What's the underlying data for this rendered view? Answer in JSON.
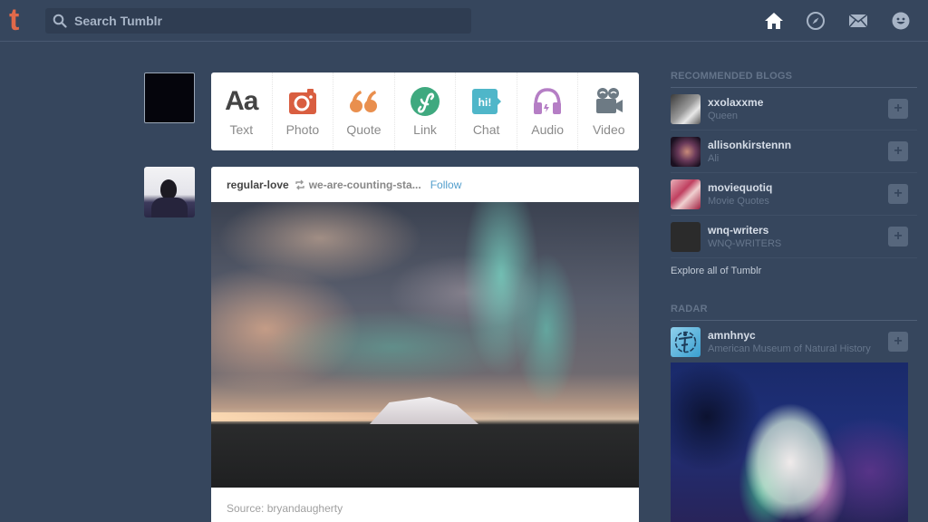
{
  "header": {
    "logo": "t",
    "search_placeholder": "Search Tumblr",
    "nav": [
      "home-icon",
      "explore-compass-icon",
      "inbox-mail-icon",
      "account-smiley-icon"
    ]
  },
  "post_types": [
    {
      "label": "Text",
      "icon": "text-icon",
      "color": "#444444"
    },
    {
      "label": "Photo",
      "icon": "camera-icon",
      "color": "#d95e40"
    },
    {
      "label": "Quote",
      "icon": "quote-icon",
      "color": "#f2992e"
    },
    {
      "label": "Link",
      "icon": "link-icon",
      "color": "#56bc8a"
    },
    {
      "label": "Chat",
      "icon": "chat-icon",
      "color": "#529ecc"
    },
    {
      "label": "Audio",
      "icon": "headphones-icon",
      "color": "#a77dc2"
    },
    {
      "label": "Video",
      "icon": "video-camera-icon",
      "color": "#748089"
    }
  ],
  "post": {
    "author": "regular-love",
    "reblogged_from": "we-are-counting-sta...",
    "follow_label": "Follow",
    "source": "Source: bryandaugherty"
  },
  "sidebar": {
    "recommended_title": "RECOMMENDED BLOGS",
    "blogs": [
      {
        "name": "xxolaxxme",
        "desc": "Queen"
      },
      {
        "name": "allisonkirstennn",
        "desc": "Ali"
      },
      {
        "name": "moviequotiq",
        "desc": "Movie Quotes"
      },
      {
        "name": "wnq-writers",
        "desc": "WNQ-WRITERS"
      }
    ],
    "explore_label": "Explore all of Tumblr",
    "radar_title": "RADAR",
    "radar": {
      "name": "amnhnyc",
      "desc": "American Museum of Natural History"
    },
    "follow_symbol": "+"
  },
  "colors": {
    "background": "#36465d",
    "brand": "#e0694a",
    "link": "#529ecc"
  }
}
